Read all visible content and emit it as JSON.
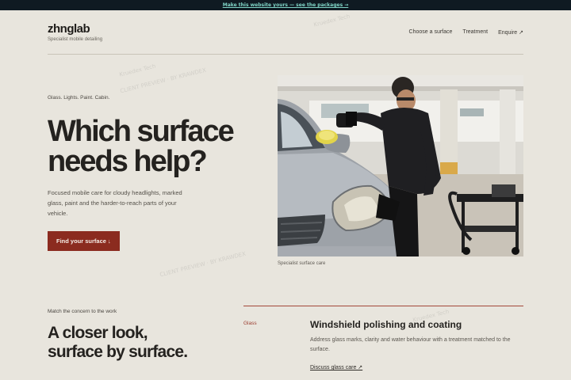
{
  "banner": {
    "text": "Make this website yours — see the packages →"
  },
  "brand": {
    "name": "zhnglab",
    "tagline": "Specialist mobile detailing"
  },
  "nav": {
    "items": [
      {
        "label": "Choose a surface"
      },
      {
        "label": "Treatment"
      },
      {
        "label": "Enquire ↗"
      }
    ]
  },
  "hero": {
    "eyebrow": "Glass. Lights. Paint. Cabin.",
    "title_line1": "Which surface",
    "title_line2": "needs help?",
    "body": "Focused mobile care for cloudy headlights, marked glass, paint and the harder-to-reach parts of your vehicle.",
    "cta": "Find your surface ↓",
    "caption": "Specialist surface care"
  },
  "section": {
    "eyebrow": "Match the concern to the work",
    "title_line1": "A closer look,",
    "title_line2": "surface by surface."
  },
  "service": {
    "category": "Glass",
    "title": "Windshield polishing and coating",
    "description": "Address glass marks, clarity and water behaviour with a treatment matched to the surface.",
    "link": "Discuss glass care ↗"
  },
  "watermark": {
    "brand": "Kruedex Tech",
    "line": "CLIENT PREVIEW · BY KRAWDEX"
  },
  "colors": {
    "background": "#e8e5dd",
    "banner_bg": "#0f1a22",
    "banner_text": "#7fd3c5",
    "accent": "#8b2b1f",
    "text": "#24221f"
  }
}
